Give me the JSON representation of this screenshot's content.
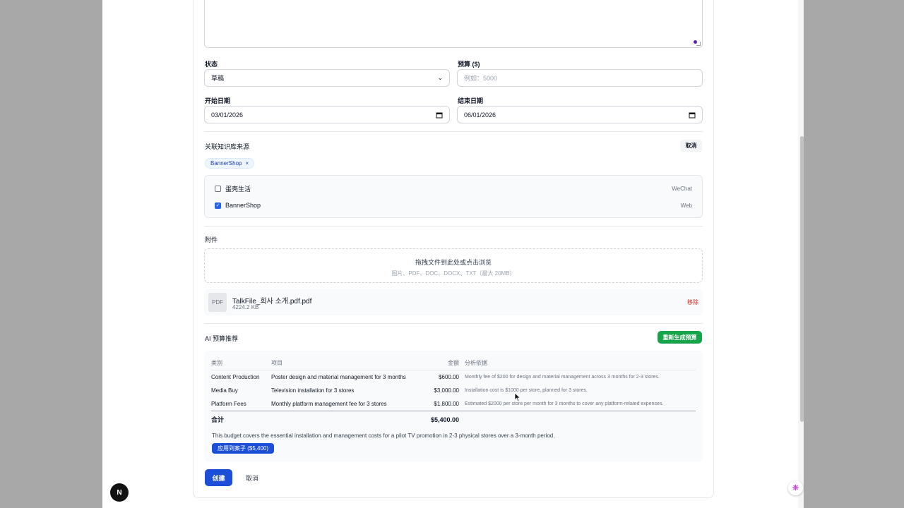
{
  "form": {
    "status_label": "状态",
    "status_value": "草稿",
    "budget_label": "预算 ($)",
    "budget_placeholder": "例如：5000",
    "start_date_label": "开始日期",
    "start_date_value": "03/01/2026",
    "end_date_label": "结束日期",
    "end_date_value": "06/01/2026"
  },
  "knowledge": {
    "title": "关联知识库来源",
    "cancel_label": "取消",
    "selected_tag": "BannerShop",
    "tag_remove": "×",
    "sources": [
      {
        "name": "蛋壳生活",
        "type": "WeChat",
        "checked": false
      },
      {
        "name": "BannerShop",
        "type": "Web",
        "checked": true
      }
    ]
  },
  "attachments": {
    "title": "附件",
    "dropzone_main": "拖拽文件到此处或点击浏览",
    "dropzone_sub": "图片、PDF、DOC、DOCX、TXT（最大 20MB）",
    "file_icon": "PDF",
    "file_name": "TalkFile_회사 소개.pdf.pdf",
    "file_size": "4224.2 KB",
    "remove_label": "移除"
  },
  "ai_budget": {
    "title": "AI 预算推荐",
    "regenerate_label": "重新生成预算",
    "headers": {
      "category": "类别",
      "item": "项目",
      "amount": "金额",
      "reason": "分析依据"
    },
    "rows": [
      {
        "category": "Content Production",
        "item": "Poster design and material management for 3 months",
        "amount": "$600.00",
        "reason": "Monthly fee of $200 for design and material management across 3 months for 2-3 stores."
      },
      {
        "category": "Media Buy",
        "item": "Television installation for 3 stores",
        "amount": "$3,000.00",
        "reason": "Installation cost is $1000 per store, planned for 3 stores."
      },
      {
        "category": "Platform Fees",
        "item": "Monthly platform management fee for 3 stores",
        "amount": "$1,800.00",
        "reason": "Estimated $2000 per store per month for 3 months to cover any platform-related expenses."
      }
    ],
    "total_label": "合计",
    "total_value": "$5,400.00",
    "summary": "This budget covers the essential installation and management costs for a pilot TV promotion in 2-3 physical stores over a 3-month period.",
    "apply_label": "应用到案子 ($5,400)"
  },
  "actions": {
    "create_label": "创建",
    "cancel_label": "取消"
  },
  "misc": {
    "next_badge": "N",
    "assistant_icon": "brain-icon",
    "accent_blue": "#1d4ed8",
    "accent_green": "#16a34a",
    "danger_red": "#dc2626"
  }
}
